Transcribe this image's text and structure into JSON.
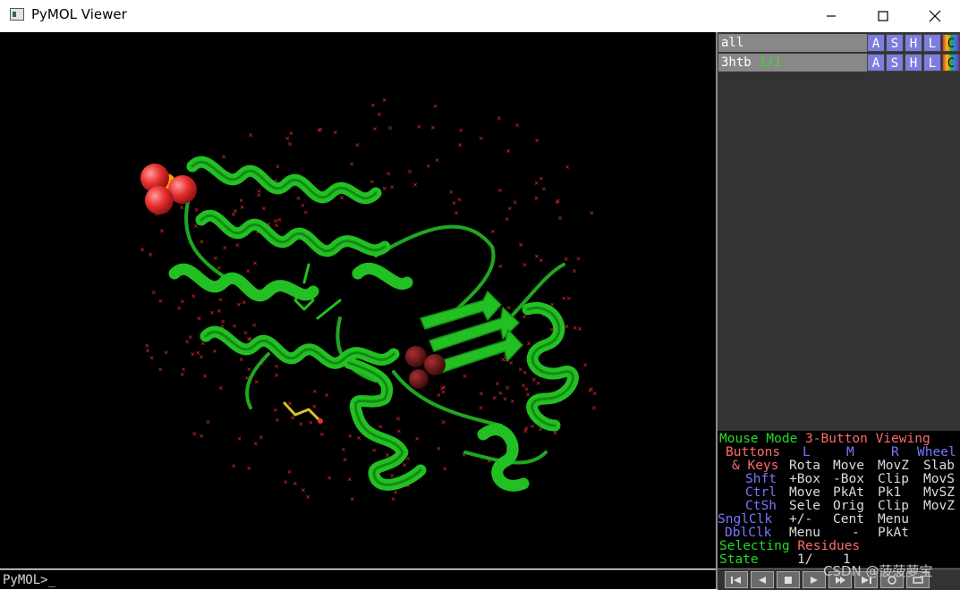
{
  "window": {
    "title": "PyMOL Viewer",
    "minimize_icon": "minimize-icon",
    "maximize_icon": "maximize-icon",
    "close_icon": "close-icon"
  },
  "objects": [
    {
      "name": "all",
      "state": "",
      "buttons": [
        "A",
        "S",
        "H",
        "L",
        "C"
      ]
    },
    {
      "name": "3htb",
      "state": "1/1",
      "buttons": [
        "A",
        "S",
        "H",
        "L",
        "C"
      ]
    }
  ],
  "mouse_panel": {
    "mode_label": "Mouse Mode",
    "mode_value": "3-Button Viewing",
    "buttons_label": "Buttons",
    "col_l": "L",
    "col_m": "M",
    "col_r": "R",
    "col_wheel": "Wheel",
    "rows": [
      {
        "key": "& Keys",
        "l": "Rota",
        "m": "Move",
        "r": "MovZ",
        "wheel": "Slab"
      },
      {
        "key": "Shft",
        "l": "+Box",
        "m": "-Box",
        "r": "Clip",
        "wheel": "MovS"
      },
      {
        "key": "Ctrl",
        "l": "Move",
        "m": "PkAt",
        "r": "Pk1",
        "wheel": "MvSZ"
      },
      {
        "key": "CtSh",
        "l": "Sele",
        "m": "Orig",
        "r": "Clip",
        "wheel": "MovZ"
      },
      {
        "key": "SnglClk",
        "l": "+/-",
        "m": "Cent",
        "r": "Menu",
        "wheel": ""
      },
      {
        "key": "DblClk",
        "l": "Menu",
        "m": "-",
        "r": "PkAt",
        "wheel": ""
      }
    ],
    "selecting_label": "Selecting",
    "selecting_value": "Residues",
    "state_label": "State",
    "state_current": "1/",
    "state_total": "1"
  },
  "controls": [
    "rewind-icon",
    "back-icon",
    "stop-icon",
    "play-icon",
    "forward-icon",
    "end-icon",
    "sculpt-icon",
    "movie-icon"
  ],
  "command_prompt": "PyMOL>_",
  "watermark": "CSDN @菠菠萝宝",
  "colors": {
    "cartoon": "#22c022",
    "water": "#ff3333",
    "sphere": "#e83030",
    "phosphorus": "#ff9900",
    "panel_bg": "#333333",
    "viewport_bg": "#000000"
  }
}
